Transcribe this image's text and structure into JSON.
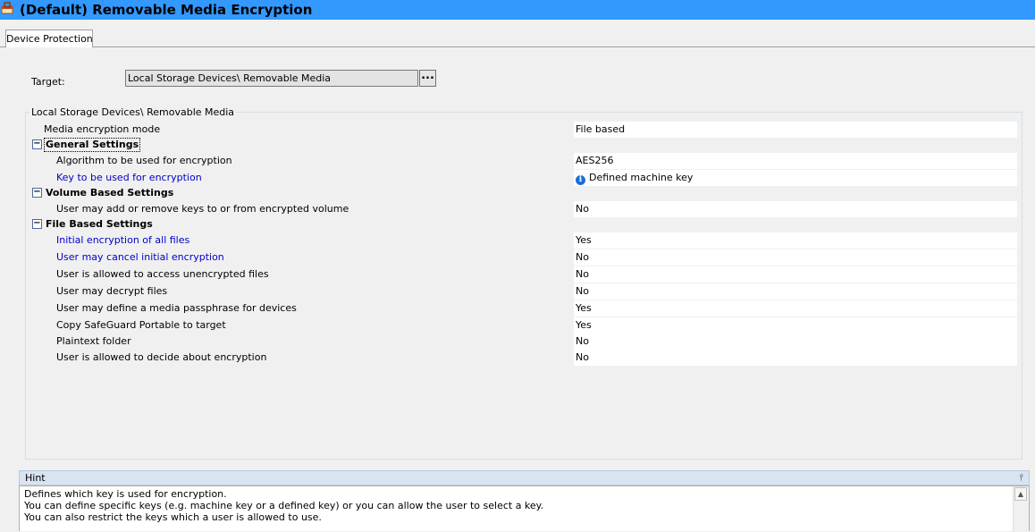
{
  "window": {
    "title": "(Default) Removable Media Encryption",
    "icon": "policy-icon"
  },
  "tabs": [
    {
      "label": "Device Protection",
      "selected": true
    }
  ],
  "target": {
    "label": "Target:",
    "value": "Local Storage Devices\\ Removable Media",
    "browse_label": "..."
  },
  "properties": {
    "group_title": "Local Storage Devices\\ Removable Media",
    "mode": {
      "name": "Media encryption mode",
      "value": "File based"
    },
    "categories": [
      {
        "label": "General Settings",
        "expanded": true,
        "items": [
          {
            "name": "Algorithm to be used for encryption",
            "value": "AES256",
            "link": false
          },
          {
            "name": "Key to be used for encryption",
            "value": "Defined machine key",
            "link": true,
            "icon": "info-icon"
          }
        ]
      },
      {
        "label": "Volume Based Settings",
        "expanded": true,
        "items": [
          {
            "name": "User may add or remove keys to or from encrypted volume",
            "value": "No",
            "link": false
          }
        ]
      },
      {
        "label": "File Based Settings",
        "expanded": true,
        "items": [
          {
            "name": "Initial encryption of all files",
            "value": "Yes",
            "link": true
          },
          {
            "name": "User may cancel initial encryption",
            "value": "No",
            "link": true
          },
          {
            "name": "User is allowed to access unencrypted files",
            "value": "No",
            "link": false
          },
          {
            "name": "User may decrypt files",
            "value": "No",
            "link": false
          },
          {
            "name": "User may define a media passphrase for devices",
            "value": "Yes",
            "link": false
          },
          {
            "name": "Copy SafeGuard Portable to target",
            "value": "Yes",
            "link": false
          },
          {
            "name": "Plaintext folder",
            "value": "No",
            "link": false
          },
          {
            "name": "User is allowed to decide about encryption",
            "value": "No",
            "link": false
          }
        ]
      }
    ]
  },
  "hint": {
    "title": "Hint",
    "lines": [
      "Defines which key is used for encryption.",
      "You can define specific keys (e.g. machine key or a defined key) or you can allow the user to select a key.",
      "You can also restrict the keys which a user is allowed to use."
    ]
  },
  "colors": {
    "titlebar": "#3399ff",
    "link_text": "#0000cc",
    "hint_header": "#d8e4f1"
  }
}
